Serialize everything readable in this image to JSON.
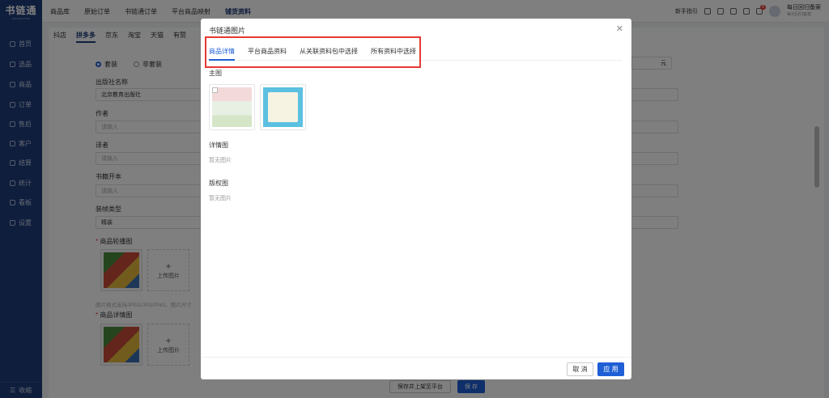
{
  "sidebar": {
    "logo": "书链通",
    "logo_sub": "SHULIAN TONG",
    "items": [
      {
        "label": "首页"
      },
      {
        "label": "选品"
      },
      {
        "label": "商品"
      },
      {
        "label": "订单"
      },
      {
        "label": "售后"
      },
      {
        "label": "客户"
      },
      {
        "label": "结算"
      },
      {
        "label": "统计"
      },
      {
        "label": "看板"
      },
      {
        "label": "设置"
      }
    ],
    "collapse_label": "收缩"
  },
  "topbar": {
    "nav": [
      {
        "label": "商品库",
        "active": false
      },
      {
        "label": "原始订单",
        "active": false
      },
      {
        "label": "书链通订单",
        "active": false
      },
      {
        "label": "平台商品映射",
        "active": false
      },
      {
        "label": "铺货资料",
        "active": true
      }
    ],
    "guide_label": "新手指引",
    "notification_count": "8",
    "user_name": "每日回归备案",
    "user_sub": "每日回归备案"
  },
  "page": {
    "subtabs": [
      {
        "label": "抖店",
        "active": false
      },
      {
        "label": "拼多多",
        "active": true
      },
      {
        "label": "京东",
        "active": false
      },
      {
        "label": "淘宝",
        "active": false
      },
      {
        "label": "天猫",
        "active": false
      },
      {
        "label": "有赞",
        "active": false
      }
    ],
    "radio_set": "套装",
    "radio_nonset": "非套装",
    "publisher_label": "出版社名称",
    "publisher_value": "北京教育出版社",
    "author_label": "作者",
    "author_placeholder": "请输入",
    "translator_label": "译者",
    "translator_placeholder": "请输入",
    "format_label": "书籍开本",
    "format_placeholder": "请输入",
    "binding_label": "装帧类型",
    "binding_value": "精装",
    "carousel_label": "商品轮播图",
    "upload_label": "上传图片",
    "format_hint": "图片格式支持JPEG/JPG/PNG，图片尺寸",
    "detail_label": "商品详情图",
    "price_unit": "元",
    "save_publish_label": "保存并上架至平台",
    "save_label": "保 存"
  },
  "modal": {
    "title": "书链通图片",
    "tabs": [
      {
        "label": "商品详情",
        "active": true
      },
      {
        "label": "平台商品资料",
        "active": false
      },
      {
        "label": "从关联资料包中选择",
        "active": false
      },
      {
        "label": "所有资料中选择",
        "active": false
      }
    ],
    "main_label": "主图",
    "detail_label": "详情图",
    "detail_empty": "暂无图片",
    "copyright_label": "版权图",
    "copyright_empty": "暂无图片",
    "cancel_label": "取 消",
    "apply_label": "应 用"
  },
  "colors": {
    "sidebar": "#1f3d7a",
    "accent": "#1f5fd6",
    "highlight": "#e53935"
  }
}
